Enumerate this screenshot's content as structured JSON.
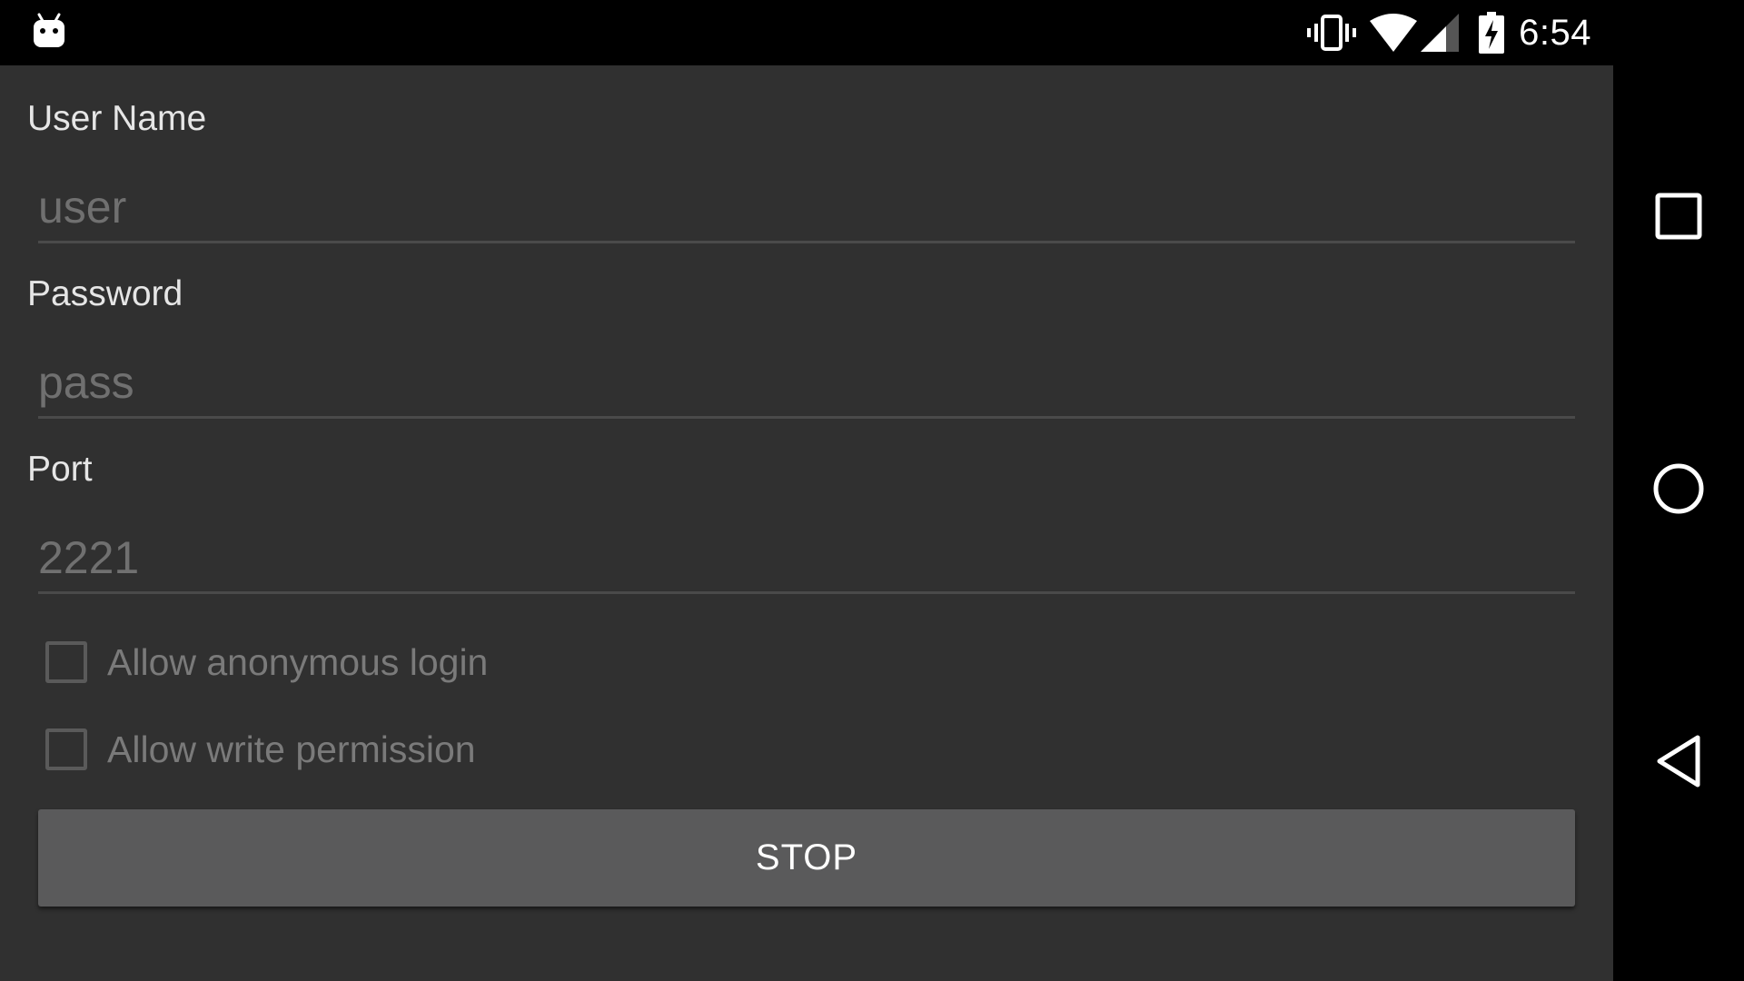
{
  "status_bar": {
    "time": "6:54",
    "icons": [
      "android-notification-icon",
      "vibrate-icon",
      "wifi-icon",
      "cellular-signal-icon",
      "battery-charging-icon"
    ]
  },
  "form": {
    "username": {
      "label": "User Name",
      "placeholder": "user"
    },
    "password": {
      "label": "Password",
      "placeholder": "pass"
    },
    "port": {
      "label": "Port",
      "placeholder": "2221"
    },
    "anonymous": {
      "label": "Allow anonymous login",
      "checked": false
    },
    "write": {
      "label": "Allow write permission",
      "checked": false
    },
    "stop_label": "STOP"
  },
  "navigation": {
    "icons": [
      "recents-icon",
      "home-icon",
      "back-icon"
    ]
  },
  "colors": {
    "background": "#303030",
    "bars": "#000000",
    "button": "#5a5a5b",
    "label_text": "#e6e6e6",
    "hint_text": "#707070"
  }
}
